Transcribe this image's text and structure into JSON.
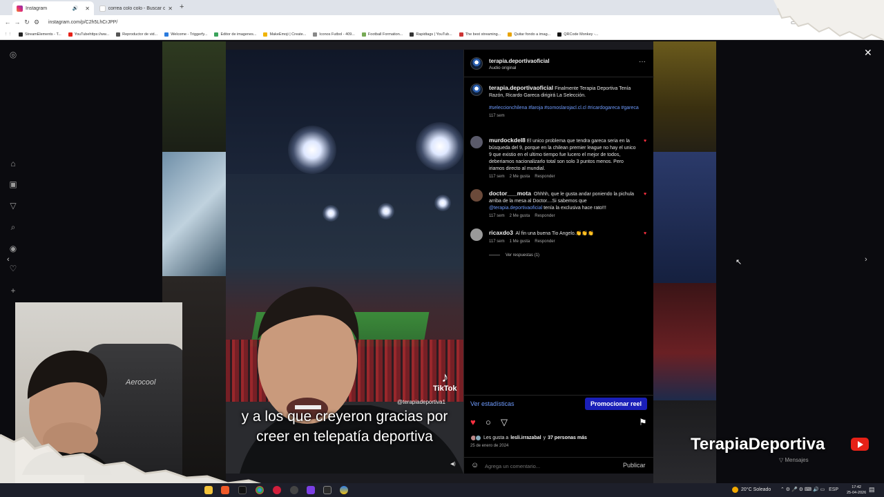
{
  "browser": {
    "tabs": [
      {
        "label": "Instagram",
        "active": true
      },
      {
        "label": "correa colo colo - Buscar con G",
        "active": false
      }
    ],
    "url": "instagram.com/p/C2h5LhCrJPP/",
    "bookmarks": [
      "StreamElements - T...",
      "YouTubehttps://ww...",
      "Reproductor de vid...",
      "Welcome - Triggerfy...",
      "Editor de imagenes...",
      "MakeEmoji | Create...",
      "Iconos Futbol - 409...",
      "Football Formation...",
      "Rapidtags | YouTub...",
      "The best streaming...",
      "Quitar fondo a imag...",
      "QRCode Monkey -..."
    ]
  },
  "video": {
    "tiktok_label": "TikTok",
    "tiktok_handle": "@terapiadeportiva1",
    "caption": "y a los que creyeron gracias por creer en telepatía deportiva",
    "chair_brand": "Aerocool"
  },
  "post": {
    "username": "terapia.deportivaoficial",
    "audio": "Audio original",
    "caption_user": "terapia.deportivaoficial",
    "caption_text": "Finalmente Terapia Deportiva Tenía Razón, Ricardo Gareca dirigirá La Selección.",
    "hashtags": "#seleccionchilena #laroja #somoslarojacl.cl.cl #ricardogareca #gareca",
    "caption_time": "117 sem",
    "comments": [
      {
        "user": "murdockdel8",
        "text": "El unico problema que tendra gareca seria en la búsqueda del 9, porque en la chilean premier league no hay el unico 9 que existio en el ultimo tiempo fue lucero el mejor de todos, deberiamos nacionalizarlo total son solo 3 puntos menos. Pero iriamos directo al mundial.",
        "time": "117 sem",
        "likes": "2 Me gusta",
        "reply": "Responder"
      },
      {
        "user": "doctor___mota",
        "text_before": "Ohhhh, que le gusta andar poniendo la pichula arriba de la mesa al Doctor....Si sabemos que",
        "mention": "@terapia.deportivaoficial",
        "text_after": "tenía la exclusiva hace rato!!!",
        "time": "117 sem",
        "likes": "2 Me gusta",
        "reply": "Responder"
      },
      {
        "user": "ricaxdo3",
        "text": "Al fin una buena Tio Angelo.👏👏👏",
        "time": "117 sem",
        "likes": "1 Me gusta",
        "reply": "Responder"
      }
    ],
    "view_replies": "Ver respuestas (1)",
    "stats_link": "Ver estadísticas",
    "promote_button": "Promocionar reel",
    "likes_prefix": "Les gusta a",
    "likes_user": "lesli.irrazabal",
    "likes_and": "y",
    "likes_others": "37 personas más",
    "date": "25 de enero de 2024",
    "comment_placeholder": "Agrega un comentario...",
    "publish": "Publicar"
  },
  "overlay": {
    "brand": "TerapiaDeportiva",
    "messages": "Mensajes"
  },
  "taskbar": {
    "weather": "20°C Soleado",
    "lang": "ESP",
    "time": "17:42",
    "date": "25-04-2026"
  },
  "colors": {
    "ig_link": "#6f9cff",
    "promote_bg": "#1a1fb8",
    "heart": "#ff3040",
    "youtube_red": "#e62117"
  }
}
